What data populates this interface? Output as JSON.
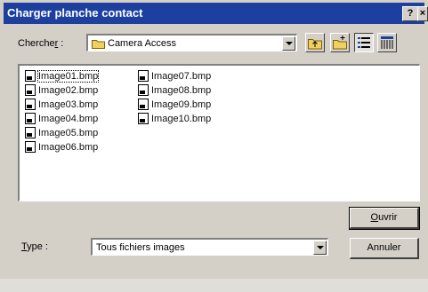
{
  "window": {
    "title": "Charger planche contact",
    "help_label": "?",
    "close_label": "×"
  },
  "look_in": {
    "label_pre": "Cherche",
    "label_mnemonic": "r",
    "label_post": " :",
    "value": "Camera Access"
  },
  "toolbar": {
    "icons": [
      "up-folder-icon",
      "new-folder-icon",
      "list-view-icon",
      "details-view-icon"
    ]
  },
  "files": [
    {
      "name": "Image01.bmp",
      "selected": true
    },
    {
      "name": "Image02.bmp",
      "selected": false
    },
    {
      "name": "Image03.bmp",
      "selected": false
    },
    {
      "name": "Image04.bmp",
      "selected": false
    },
    {
      "name": "Image05.bmp",
      "selected": false
    },
    {
      "name": "Image06.bmp",
      "selected": false
    },
    {
      "name": "Image07.bmp",
      "selected": false
    },
    {
      "name": "Image08.bmp",
      "selected": false
    },
    {
      "name": "Image09.bmp",
      "selected": false
    },
    {
      "name": "Image10.bmp",
      "selected": false
    }
  ],
  "type": {
    "label_mnemonic": "T",
    "label_post": "ype :",
    "value": "Tous fichiers images"
  },
  "buttons": {
    "open_mnemonic": "O",
    "open_post": "uvrir",
    "cancel": "Annuler"
  }
}
